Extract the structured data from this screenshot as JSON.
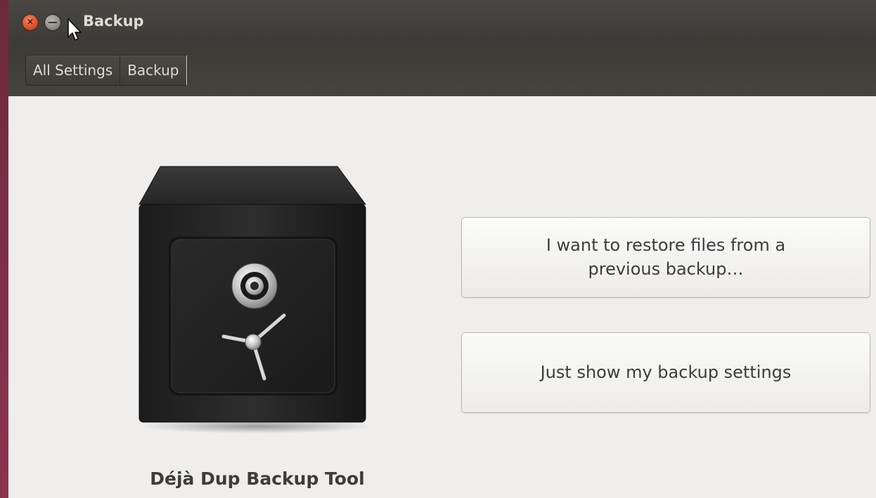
{
  "window": {
    "title": "Backup"
  },
  "breadcrumb": {
    "items": [
      {
        "label": "All Settings"
      },
      {
        "label": "Backup"
      }
    ]
  },
  "main": {
    "app_name": "Déjà Dup Backup Tool",
    "restore_button_label": "I want to restore files from a previous backup…",
    "settings_button_label": "Just show my backup settings"
  },
  "icons": {
    "close": "close-icon",
    "minimize": "minimize-icon",
    "cursor": "mouse-pointer-icon",
    "app": "safe-icon"
  },
  "colors": {
    "close_button": "#e0502b",
    "titlebar": "#3d3b37",
    "content_background": "#efeeed"
  }
}
